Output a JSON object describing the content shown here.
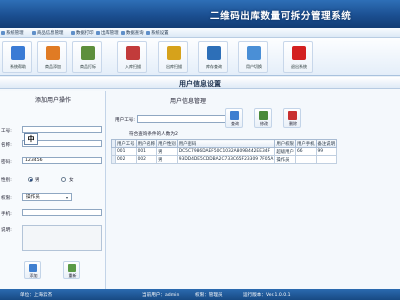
{
  "app": {
    "title": "二维码出库数量可拆分管理系统"
  },
  "menu": [
    "系统管理",
    "商品信息管理",
    "数据打印",
    "出库管理",
    "数据查询",
    "系统设置"
  ],
  "toolbar": [
    {
      "label": "系统帮助",
      "icon": "help-icon",
      "color": "#3a7bd5"
    },
    {
      "label": "商品添加",
      "icon": "product-add-icon",
      "color": "#e07b24"
    },
    {
      "label": "商品打标",
      "icon": "label-print-icon",
      "color": "#5d8f3c"
    },
    {
      "label": "入库扫描",
      "icon": "scan-in-icon",
      "color": "#c23b3b"
    },
    {
      "label": "出库扫描",
      "icon": "scan-out-icon",
      "color": "#d6a21b"
    },
    {
      "label": "库存查询",
      "icon": "stock-query-icon",
      "color": "#2d6fb8"
    },
    {
      "label": "用户切换",
      "icon": "user-switch-icon",
      "color": "#4a8fd6"
    },
    {
      "label": "退出系统",
      "icon": "exit-icon",
      "color": "#d32020"
    }
  ],
  "main": {
    "title": "用户信息设置"
  },
  "left": {
    "title": "添加用户操作",
    "fields": {
      "user_no_label": "工号:",
      "user_no": "",
      "name_label": "名称:",
      "name": "",
      "password_label": "密码:",
      "password": "123456",
      "gender_label": "性别:",
      "gender_male": "男",
      "gender_female": "女",
      "role_label": "权限:",
      "role": "操作员",
      "phone_label": "手机:",
      "phone": "",
      "note_label": "说明:",
      "note": ""
    },
    "popup_char": "中",
    "buttons": {
      "add": "添加",
      "reset": "重新"
    }
  },
  "right": {
    "title": "用户信息管理",
    "search_label": "用户工号:",
    "search_value": "",
    "buttons": {
      "query": "查询",
      "edit": "修改",
      "delete": "删除"
    },
    "count_text": "符合查询条件的人数为2",
    "columns": [
      "用户工号",
      "用户名称",
      "用户性别",
      "用户密码",
      "用户权限",
      "用户手机",
      "备注说明"
    ],
    "rows": [
      [
        "001",
        "001",
        "男",
        "DC5C7986DAEF50C1032A809B442EE34F",
        "超级用户",
        "66",
        "99"
      ],
      [
        "002",
        "002",
        "男",
        "93DD4DE5CDDBA2C733C65F23309 7F05A",
        "操作员",
        "",
        ""
      ]
    ]
  },
  "status": {
    "unit": "单位：上海云杰",
    "user": "当前用户：admin",
    "role": "权限：管理员",
    "version": "运行版本：Ver.1.0.0.1"
  }
}
